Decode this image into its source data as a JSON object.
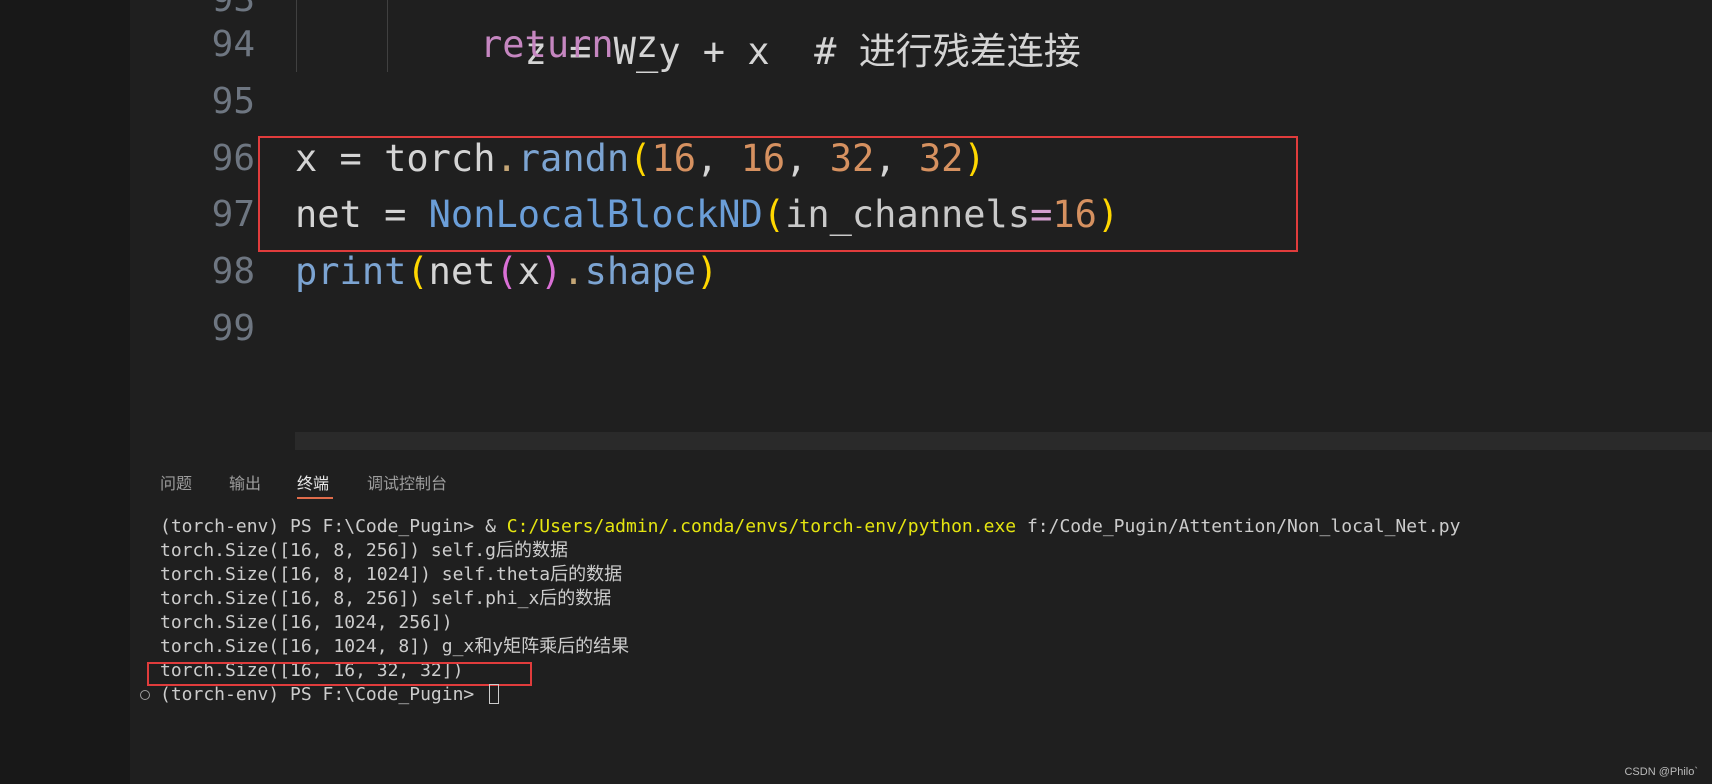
{
  "editor": {
    "line_numbers": [
      "93",
      "94",
      "95",
      "96",
      "97",
      "98",
      "99"
    ],
    "line_93_partial": "z = W_y + x  # 进行残差连接",
    "line_94": {
      "keyword": "return",
      "var": " z"
    },
    "line_96": {
      "var": "x",
      "op": " = ",
      "module": "torch",
      "dot": ".",
      "fn": "randn",
      "open": "(",
      "args": [
        "16",
        "16",
        "32",
        "32"
      ],
      "sep": ", ",
      "close": ")"
    },
    "line_97": {
      "var": "net",
      "op": " = ",
      "cls": "NonLocalBlockND",
      "open": "(",
      "param": "in_channels",
      "eq": "=",
      "num": "16",
      "close": ")"
    },
    "line_98": {
      "fn": "print",
      "open1": "(",
      "var": "net",
      "open2": "(",
      "arg": "x",
      "close2": ")",
      "dot": ".",
      "attr": "shape",
      "close1": ")"
    }
  },
  "panel": {
    "tabs": [
      {
        "label": "问题",
        "active": false
      },
      {
        "label": "输出",
        "active": false
      },
      {
        "label": "终端",
        "active": true
      },
      {
        "label": "调试控制台",
        "active": false
      }
    ]
  },
  "terminal": {
    "cmd_prompt": "(torch-env) PS F:\\Code_Pugin> & ",
    "cmd_exe": "C:/Users/admin/.conda/envs/torch-env/python.exe",
    "cmd_arg": " f:/Code_Pugin/Attention/Non_local_Net.py",
    "lines": [
      "torch.Size([16, 8, 256]) self.g后的数据",
      "torch.Size([16, 8, 1024]) self.theta后的数据",
      "torch.Size([16, 8, 256]) self.phi_x后的数据",
      "torch.Size([16, 1024, 256])",
      "torch.Size([16, 1024, 8]) g_x和y矩阵乘后的结果",
      "torch.Size([16, 16, 32, 32])"
    ],
    "final_prompt": "(torch-env) PS F:\\Code_Pugin> "
  },
  "watermark": "CSDN @Philo`",
  "colors": {
    "highlight_box": "#e03c3c",
    "keyword": "#c586c0",
    "function": "#7ca4d2",
    "number": "#d69160",
    "bracket_level1": "#ffd700",
    "bracket_level2": "#da70d6"
  }
}
